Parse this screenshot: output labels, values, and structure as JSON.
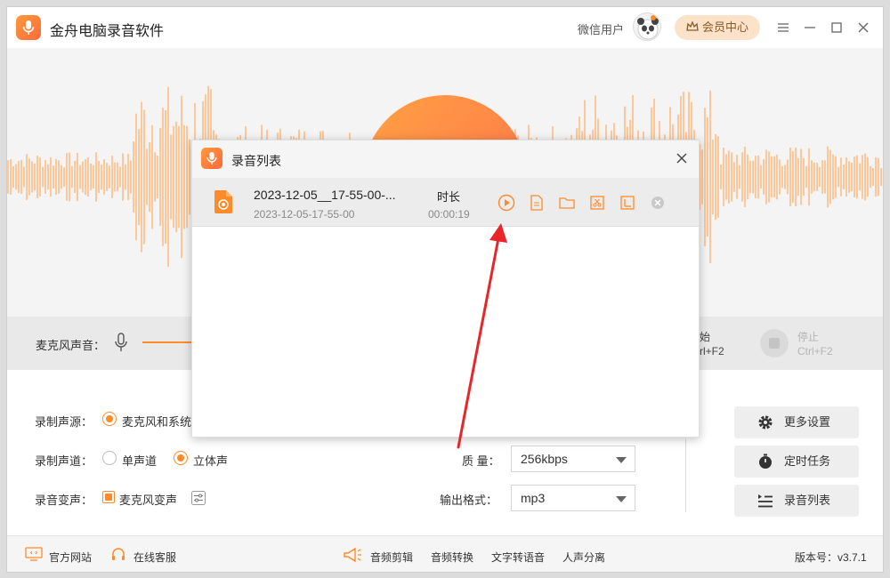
{
  "app": {
    "title": "金舟电脑录音软件",
    "user_name": "微信用户",
    "vip_label": "会员中心"
  },
  "mic": {
    "label": "麦克风声音："
  },
  "record_controls": {
    "start_text": "始",
    "start_shortcut": "rl+F2",
    "stop_text": "停止",
    "stop_shortcut": "Ctrl+F2"
  },
  "settings": {
    "source_label": "录制声源：",
    "source_option": "麦克风和系统",
    "channel_label": "录制声道：",
    "channel_options": [
      "单声道",
      "立体声"
    ],
    "channel_selected": "立体声",
    "voice_change_label": "录音变声：",
    "voice_change_option": "麦克风变声",
    "quality_label": "质  量：",
    "quality_value": "256kbps",
    "format_label": "输出格式：",
    "format_value": "mp3"
  },
  "side_buttons": {
    "more_settings": "更多设置",
    "scheduled_task": "定时任务",
    "record_list": "录音列表"
  },
  "footer": {
    "website": "官方网站",
    "service": "在线客服",
    "links": [
      "音频剪辑",
      "音频转换",
      "文字转语音",
      "人声分离"
    ],
    "version": "版本号：v3.7.1"
  },
  "modal": {
    "title": "录音列表",
    "recordings": [
      {
        "name": "2023-12-05__17-55-00-...",
        "date": "2023-12-05-17-55-00",
        "duration_label": "时长",
        "duration": "00:00:19"
      }
    ]
  },
  "colors": {
    "accent": "#ff8a2a",
    "wave": "#fcc89a",
    "annotation": "#e8262a"
  }
}
